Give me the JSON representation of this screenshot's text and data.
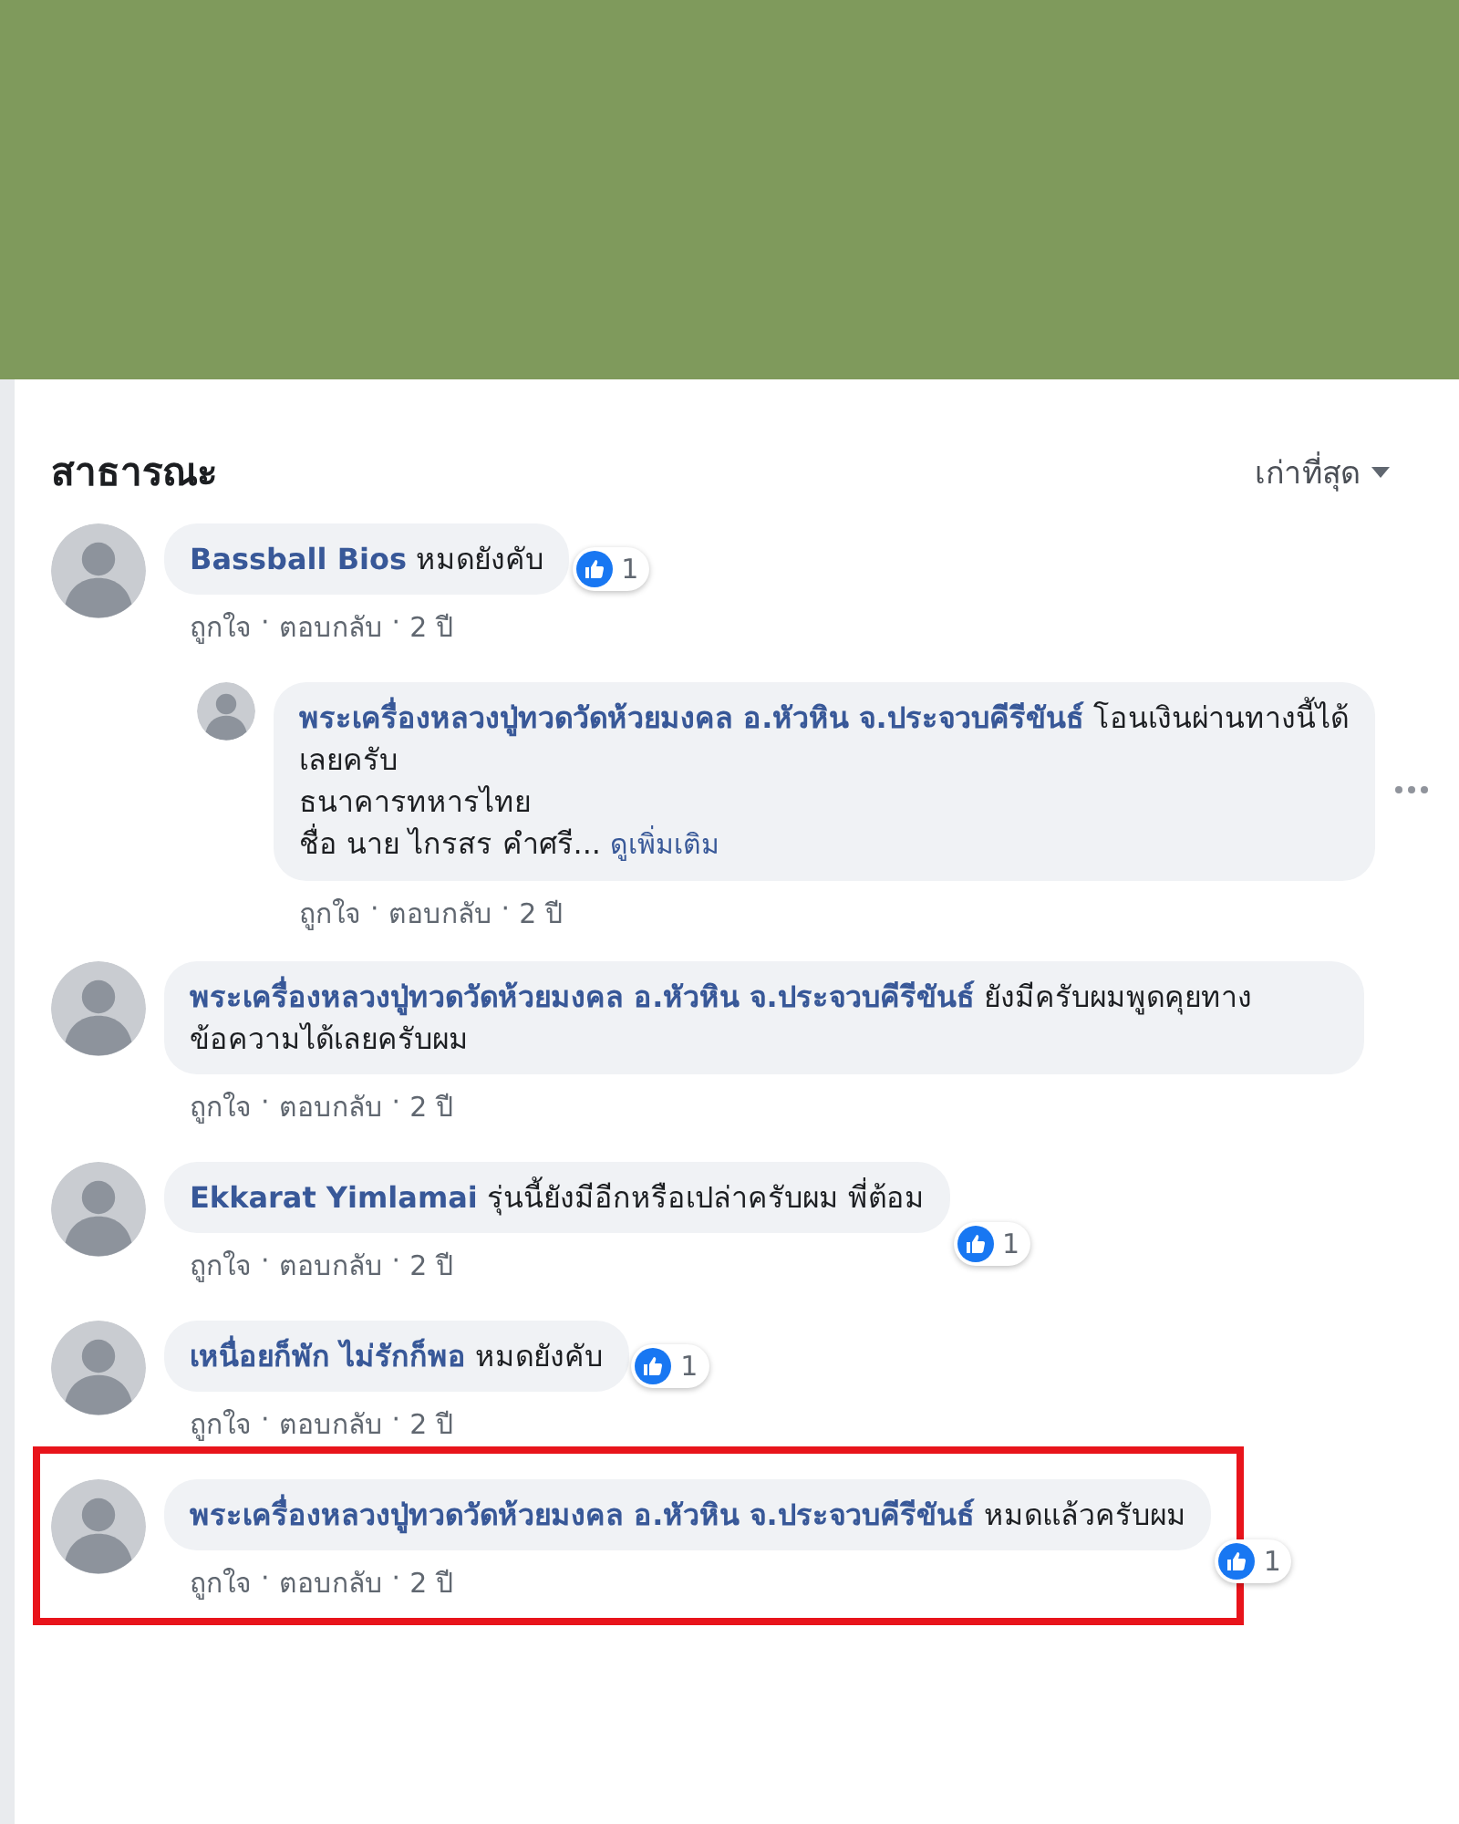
{
  "section": {
    "title": "สาธารณะ",
    "sort": {
      "label": "เก่าที่สุด"
    }
  },
  "separator": "·",
  "comments": [
    {
      "author": "Bassball Bios",
      "text": "หมดยังคับ",
      "likes": "1",
      "actions": [
        "ถูกใจ",
        "ตอบกลับ"
      ],
      "time": "2 ปี",
      "highlighted": false,
      "replies": [
        {
          "author": "พระเครื่องหลวงปู่ทวดวัดห้วยมงคล อ.หัวหิน จ.ประจวบคีรีขันธ์",
          "text": "โอนเงินผ่านทางนี้ได้เลยครับ\nธนาคารทหารไทย\nชื่อ นาย ไกรสร คำศรี...",
          "more_link": "ดูเพิ่มเติม",
          "actions": [
            "ถูกใจ",
            "ตอบกลับ"
          ],
          "time": "2 ปี"
        }
      ]
    },
    {
      "author": "พระเครื่องหลวงปู่ทวดวัดห้วยมงคล อ.หัวหิน จ.ประจวบคีรีขันธ์",
      "text": "ยังมีครับผมพูดคุยทางข้อความได้เลยครับผม",
      "actions": [
        "ถูกใจ",
        "ตอบกลับ"
      ],
      "time": "2 ปี",
      "highlighted": false
    },
    {
      "author": "Ekkarat Yimlamai",
      "text": "รุ่นนี้ยังมีอีกหรือเปล่าครับผม พี่ต้อม",
      "likes": "1",
      "actions": [
        "ถูกใจ",
        "ตอบกลับ"
      ],
      "time": "2 ปี",
      "highlighted": false
    },
    {
      "author": "เหนื่อยก็พัก ไม่รักก็พอ",
      "text": "หมดยังคับ",
      "likes": "1",
      "actions": [
        "ถูกใจ",
        "ตอบกลับ"
      ],
      "time": "2 ปี",
      "highlighted": false
    },
    {
      "author": "พระเครื่องหลวงปู่ทวดวัดห้วยมงคล อ.หัวหิน จ.ประจวบคีรีขันธ์",
      "text": "หมดแล้วครับผม",
      "likes": "1",
      "actions": [
        "ถูกใจ",
        "ตอบกลับ"
      ],
      "time": "2 ปี",
      "highlighted": true
    }
  ]
}
